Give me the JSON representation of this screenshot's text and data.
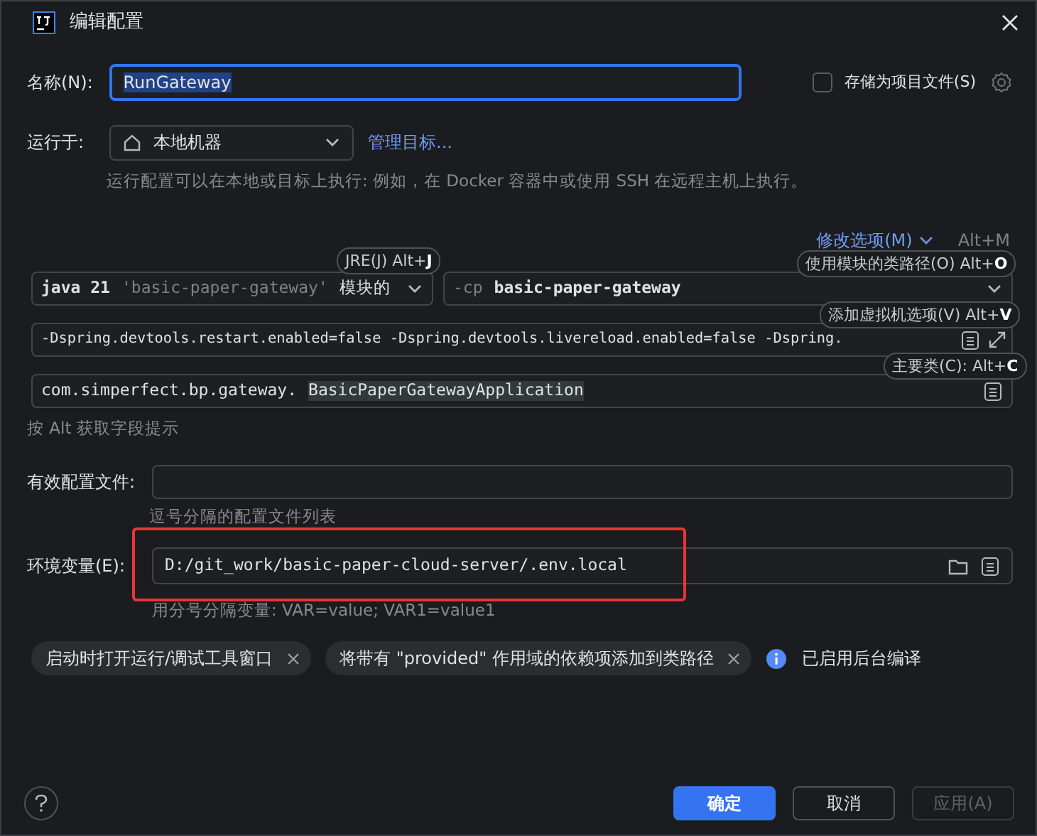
{
  "window": {
    "title": "编辑配置"
  },
  "name": {
    "label": "名称(N):",
    "value": "RunGateway"
  },
  "store_as_file": {
    "label": "存储为项目文件(S)",
    "checked": false
  },
  "run_on": {
    "label": "运行于:",
    "value": "本地机器",
    "link": "管理目标...",
    "hint": "运行配置可以在本地或目标上执行: 例如，在 Docker 容器中或使用 SSH 在远程主机上执行。"
  },
  "modify_options": {
    "label": "修改选项(M)",
    "shortcut": "Alt+M"
  },
  "jre": {
    "version": "java 21",
    "module": "'basic-paper-gateway'",
    "suffix": "模块的"
  },
  "classpath": {
    "flag": "-cp",
    "value": "basic-paper-gateway"
  },
  "vm_options": {
    "value": "-Dspring.devtools.restart.enabled=false -Dspring.devtools.livereload.enabled=false -Dspring."
  },
  "main_class": {
    "package": "com.simperfect.bp.gateway.",
    "class": "BasicPaperGatewayApplication"
  },
  "field_hint": "按 Alt 获取字段提示",
  "active_profiles": {
    "label": "有效配置文件:",
    "hint": "逗号分隔的配置文件列表"
  },
  "env_vars": {
    "label": "环境变量(E):",
    "value": "D:/git_work/basic-paper-cloud-server/.env.local",
    "hint": "用分号分隔变量: VAR=value; VAR1=value1"
  },
  "shortcut_hints": [
    {
      "text": "JRE(J) Alt+**J**"
    },
    {
      "text": "使用模块的类路径(O) Alt+**O**"
    },
    {
      "text": "添加虚拟机选项(V) Alt+**V**"
    },
    {
      "text": "主要类(C): Alt+**C**"
    }
  ],
  "chips": [
    {
      "label": "启动时打开运行/调试工具窗口"
    },
    {
      "label": "将带有 \"provided\" 作用域的依赖项添加到类路径"
    }
  ],
  "info": "已启用后台编译",
  "buttons": [
    {
      "label": "确定",
      "kind": "primary",
      "disabled": false
    },
    {
      "label": "取消",
      "kind": "default",
      "disabled": false
    },
    {
      "label": "应用(A)",
      "kind": "default",
      "disabled": true
    }
  ]
}
